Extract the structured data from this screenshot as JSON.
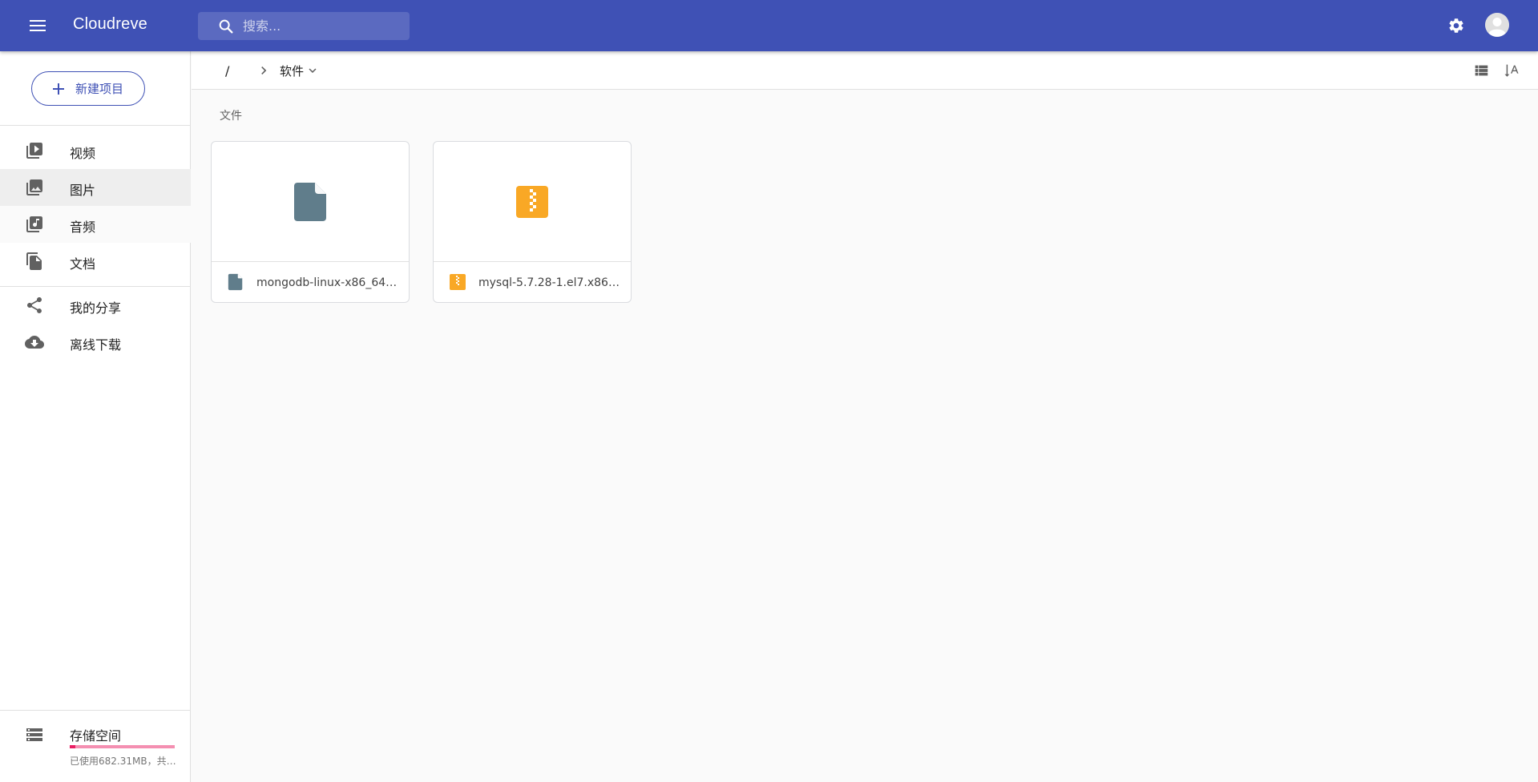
{
  "colors": {
    "primary": "#3f51b5",
    "storage_accent": "#e91e63",
    "generic_file_icon": "#607d8b",
    "archive_file_icon": "#f9a825"
  },
  "app": {
    "title": "Cloudreve",
    "search_placeholder": "搜索..."
  },
  "sidebar": {
    "new_button": "新建项目",
    "items": [
      {
        "label": "视频",
        "icon": "video-library-icon"
      },
      {
        "label": "图片",
        "icon": "photo-library-icon"
      },
      {
        "label": "音频",
        "icon": "library-music-icon"
      },
      {
        "label": "文档",
        "icon": "file-copy-icon"
      }
    ],
    "secondary": [
      {
        "label": "我的分享",
        "icon": "share-icon"
      },
      {
        "label": "离线下载",
        "icon": "cloud-download-icon"
      }
    ],
    "storage": {
      "title": "存储空间",
      "usage_text": "已使用682.31MB，共…",
      "used_fraction": 0.05
    }
  },
  "breadcrumb": {
    "root": "/",
    "current": "软件"
  },
  "main": {
    "section_title": "文件",
    "files": [
      {
        "name": "mongodb-linux-x86_64-…",
        "type": "file-icon"
      },
      {
        "name": "mysql-5.7.28-1.el7.x86_…",
        "type": "archive-icon"
      }
    ]
  }
}
